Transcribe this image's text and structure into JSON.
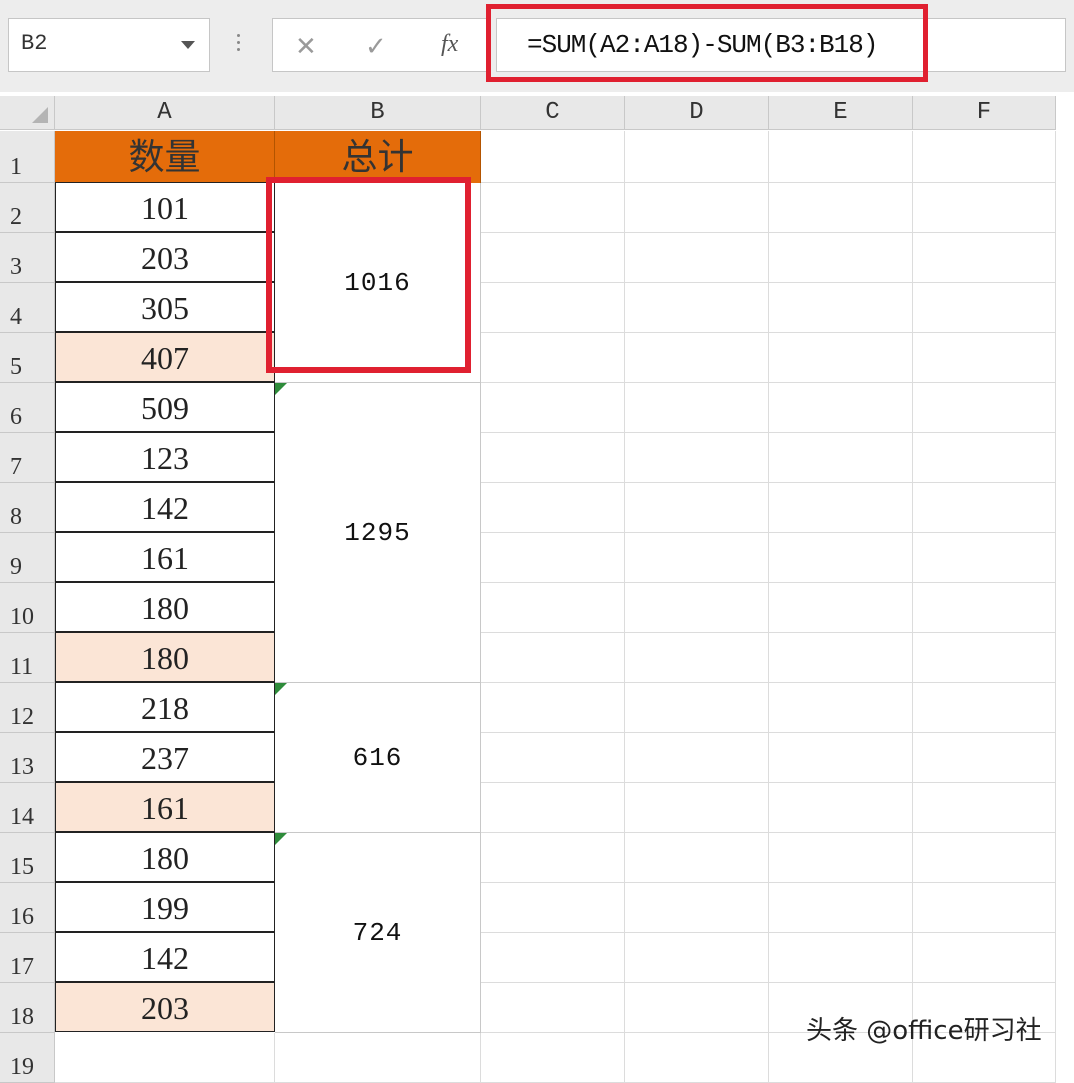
{
  "formula_bar": {
    "name_box": "B2",
    "cancel_icon": "✕",
    "enter_icon": "✓",
    "fx_label": "fx",
    "formula": "=SUM(A2:A18)-SUM(B3:B18)"
  },
  "columns": [
    "A",
    "B",
    "C",
    "D",
    "E",
    "F"
  ],
  "rows": [
    "1",
    "2",
    "3",
    "4",
    "5",
    "6",
    "7",
    "8",
    "9",
    "10",
    "11",
    "12",
    "13",
    "14",
    "15",
    "16",
    "17",
    "18",
    "19"
  ],
  "headers": {
    "a1": "数量",
    "b1": "总计"
  },
  "column_a": [
    {
      "value": "101",
      "highlight": false
    },
    {
      "value": "203",
      "highlight": false
    },
    {
      "value": "305",
      "highlight": false
    },
    {
      "value": "407",
      "highlight": true
    },
    {
      "value": "509",
      "highlight": false
    },
    {
      "value": "123",
      "highlight": false
    },
    {
      "value": "142",
      "highlight": false
    },
    {
      "value": "161",
      "highlight": false
    },
    {
      "value": "180",
      "highlight": false
    },
    {
      "value": "180",
      "highlight": true
    },
    {
      "value": "218",
      "highlight": false
    },
    {
      "value": "237",
      "highlight": false
    },
    {
      "value": "161",
      "highlight": true
    },
    {
      "value": "180",
      "highlight": false
    },
    {
      "value": "199",
      "highlight": false
    },
    {
      "value": "142",
      "highlight": false
    },
    {
      "value": "203",
      "highlight": true
    }
  ],
  "merged_b": [
    {
      "value": "1016",
      "rows": "2-5"
    },
    {
      "value": "1295",
      "rows": "6-11"
    },
    {
      "value": "616",
      "rows": "12-14"
    },
    {
      "value": "724",
      "rows": "15-18"
    }
  ],
  "colors": {
    "header_fill": "#e46c0a",
    "highlight_fill": "#fbe5d6",
    "annotation_red": "#e02030",
    "comment_green": "#2e8b3a"
  },
  "watermark": "头条 @office研习社"
}
